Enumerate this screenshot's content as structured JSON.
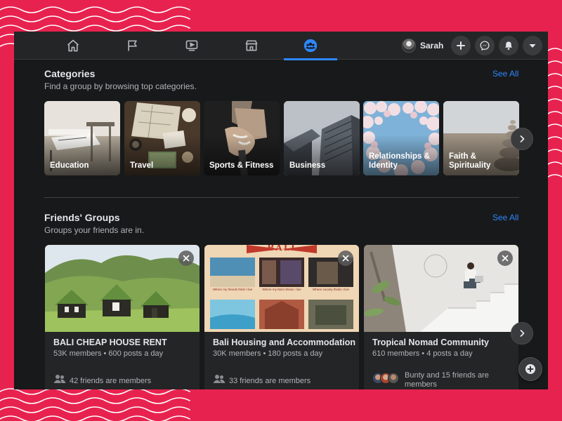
{
  "nav": {
    "items": [
      {
        "icon": "home-icon"
      },
      {
        "icon": "flag-icon"
      },
      {
        "icon": "watch-icon"
      },
      {
        "icon": "marketplace-icon"
      },
      {
        "icon": "groups-icon",
        "active": true
      }
    ],
    "profile_name": "Sarah"
  },
  "categories": {
    "title": "Categories",
    "subtitle": "Find a group by browsing top categories.",
    "see_all": "See All",
    "items": [
      {
        "label": "Education"
      },
      {
        "label": "Travel"
      },
      {
        "label": "Sports & Fitness"
      },
      {
        "label": "Business"
      },
      {
        "label": "Relationships & Identity"
      },
      {
        "label": "Faith & Spirituality"
      }
    ]
  },
  "friends_groups": {
    "title": "Friends' Groups",
    "subtitle": "Groups your friends are in.",
    "see_all": "See All",
    "groups": [
      {
        "name": "BALI CHEAP HOUSE RENT",
        "meta": "53K members • 600 posts a day",
        "friends": "42 friends are members"
      },
      {
        "name": "Bali Housing and Accommodation",
        "meta": "30K members • 180 posts a day",
        "friends": "33 friends are members",
        "banner": "BALI",
        "captions": [
          "Where my friends think I live",
          "Where my Mom thinks I live",
          "Where society thinks I live"
        ]
      },
      {
        "name": "Tropical Nomad Community",
        "meta": "610 members • 4 posts a day",
        "friends": "Bunty and 15 friends are members"
      }
    ]
  },
  "colors": {
    "accent": "#2d88ff",
    "background": "#18191a",
    "surface": "#242526",
    "frame": "#e8224f"
  }
}
